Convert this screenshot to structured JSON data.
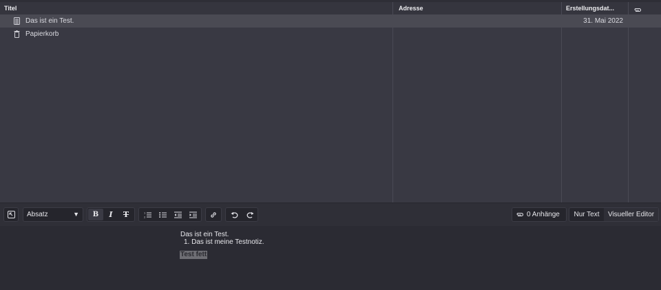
{
  "table": {
    "columns": [
      {
        "label": "Titel"
      },
      {
        "label": "Adresse"
      },
      {
        "label": "Erstellungsdat..."
      },
      {
        "label": "",
        "icon": "paperclip-icon"
      }
    ],
    "rows": [
      {
        "icon": "note-icon",
        "title": "Das ist ein Test.",
        "address": "",
        "date": "31. Mai 2022",
        "selected": true
      },
      {
        "icon": "trash-icon",
        "title": "Papierkorb",
        "address": "",
        "date": "",
        "selected": false
      }
    ]
  },
  "toolbar": {
    "collapse_icon": "collapse-icon",
    "format_select": {
      "value": "Absatz"
    },
    "formatting": [
      "bold-icon",
      "italic-icon",
      "strikethrough-icon"
    ],
    "lists": [
      "ordered-list-icon",
      "bullet-list-icon",
      "outdent-icon",
      "indent-icon"
    ],
    "link_icon": "link-icon",
    "history": [
      "undo-icon",
      "redo-icon"
    ],
    "attachments_label": "0 Anhänge",
    "mode_text": "Nur Text",
    "mode_visual": "Visueller Editor"
  },
  "editor": {
    "paragraph": "Das ist ein Test.",
    "list_item": "1. Das ist meine Testnotiz.",
    "bold_text": "Test fett"
  },
  "colors": {
    "background": "#2b2b33",
    "table_bg": "#393943",
    "selected_row": "#4a4a53",
    "text": "#e6e6ea"
  }
}
